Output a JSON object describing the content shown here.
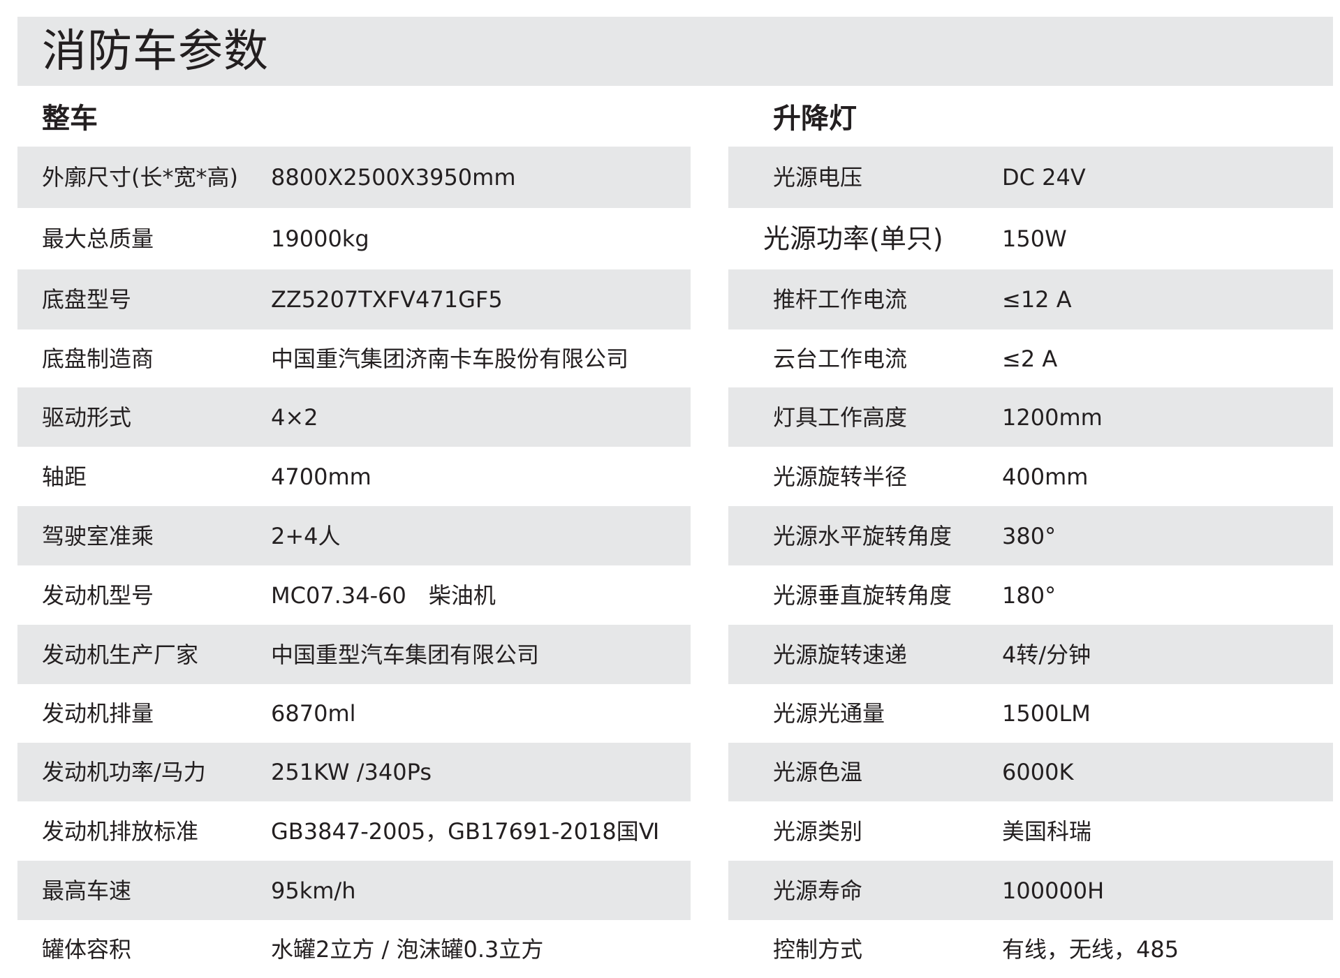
{
  "title": "消防车参数",
  "left_section": {
    "heading": "整车",
    "rows": [
      {
        "label": "外廓尺寸(长*宽*高)",
        "value": "8800X2500X3950mm"
      },
      {
        "label": "最大总质量",
        "value": "19000kg"
      },
      {
        "label": "底盘型号",
        "value": "ZZ5207TXFV471GF5"
      },
      {
        "label": "底盘制造商",
        "value": "中国重汽集团济南卡车股份有限公司"
      },
      {
        "label": "驱动形式",
        "value": "4×2"
      },
      {
        "label": "轴距",
        "value": "4700mm"
      },
      {
        "label": "驾驶室准乘",
        "value": "2+4人"
      },
      {
        "label": "发动机型号",
        "value": "MC07.34-60　柴油机"
      },
      {
        "label": "发动机生产厂家",
        "value": "中国重型汽车集团有限公司"
      },
      {
        "label": "发动机排量",
        "value": "6870ml"
      },
      {
        "label": "发动机功率/马力",
        "value": "251KW /340Ps"
      },
      {
        "label": "发动机排放标准",
        "value": "GB3847-2005，GB17691-2018国Ⅵ"
      },
      {
        "label": "最高车速",
        "value": "95km/h"
      },
      {
        "label": "罐体容积",
        "value": "水罐2立方 / 泡沫罐0.3立方"
      }
    ]
  },
  "right_section": {
    "heading": "升降灯",
    "rows": [
      {
        "label": "光源电压",
        "value": "DC 24V"
      },
      {
        "label": "光源功率(单只)",
        "value": "150W"
      },
      {
        "label": "推杆工作电流",
        "value": "≤12 A"
      },
      {
        "label": "云台工作电流",
        "value": "≤2 A"
      },
      {
        "label": "灯具工作高度",
        "value": "1200mm"
      },
      {
        "label": "光源旋转半径",
        "value": "400mm"
      },
      {
        "label": "光源水平旋转角度",
        "value": "380°"
      },
      {
        "label": "光源垂直旋转角度",
        "value": "180°"
      },
      {
        "label": "光源旋转速递",
        "value": "4转/分钟"
      },
      {
        "label": "光源光通量",
        "value": "1500LM"
      },
      {
        "label": "光源色温",
        "value": "6000K"
      },
      {
        "label": "光源类别",
        "value": "美国科瑞"
      },
      {
        "label": "光源寿命",
        "value": "100000H"
      },
      {
        "label": "控制方式",
        "value": "有线，无线，485"
      }
    ]
  }
}
